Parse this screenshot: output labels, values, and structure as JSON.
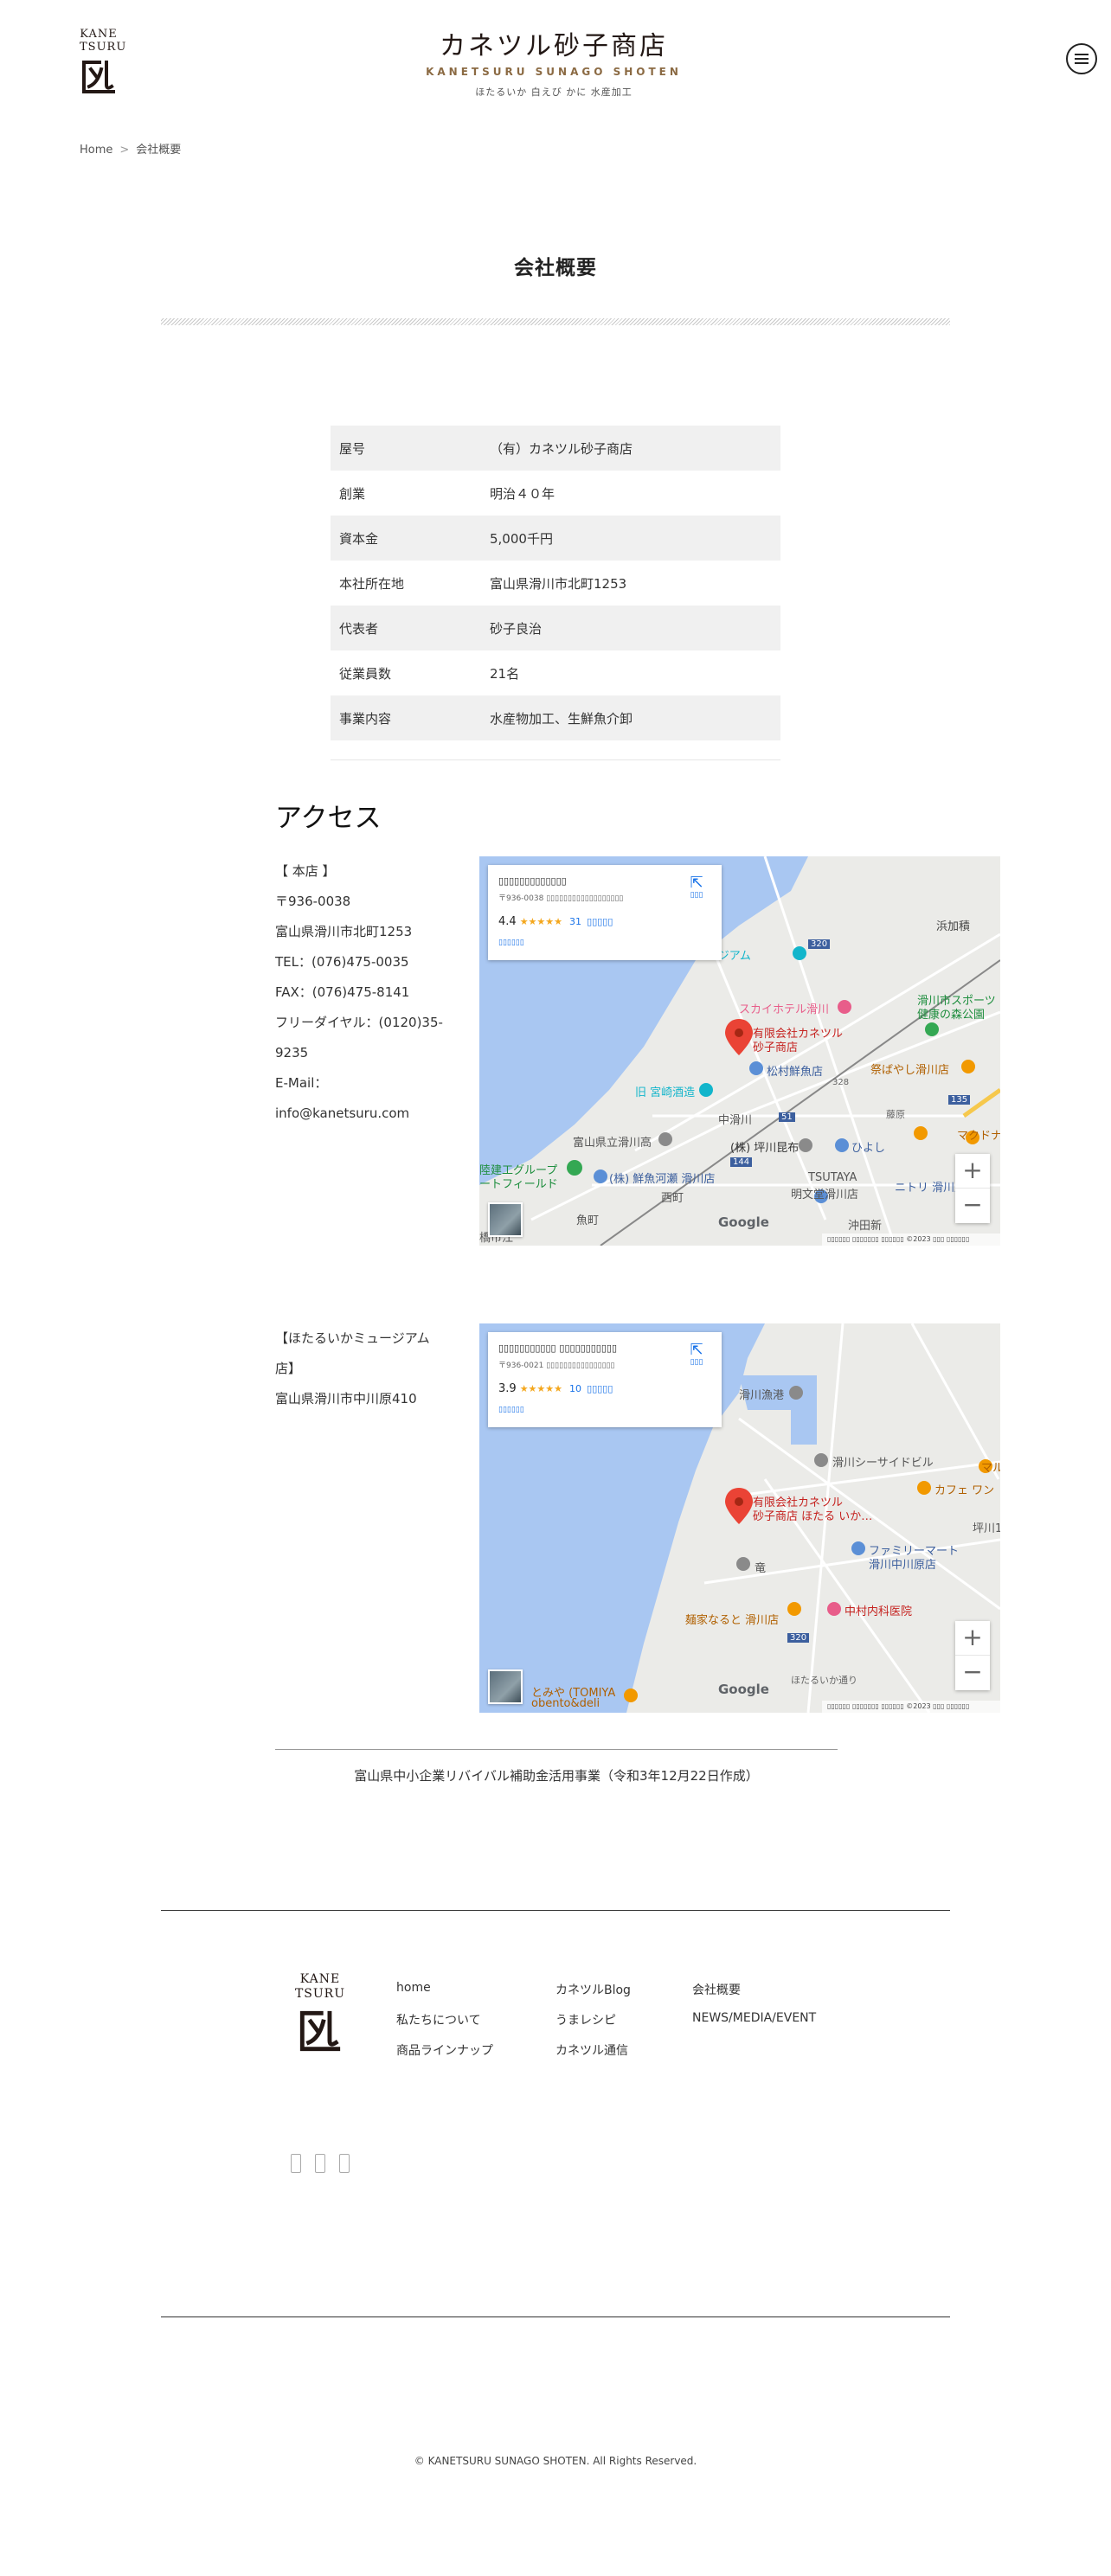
{
  "header": {
    "logo_top": "KANE",
    "logo_bottom": "TSURU",
    "brand_name": "カネツル砂子商店",
    "brand_roman": "KANETSURU SUNAGO SHOTEN",
    "brand_tagline": "ほたるいか 白えび かに 水産加工"
  },
  "breadcrumb": {
    "home": "Home",
    "separator": ">",
    "current": "会社概要"
  },
  "page_title": "会社概要",
  "company": [
    {
      "key": "屋号",
      "value": "（有）カネツル砂子商店"
    },
    {
      "key": "創業",
      "value": "明治４０年"
    },
    {
      "key": "資本金",
      "value": "5,000千円"
    },
    {
      "key": "本社所在地",
      "value": "富山県滑川市北町1253"
    },
    {
      "key": "代表者",
      "value": "砂子良治"
    },
    {
      "key": "従業員数",
      "value": "21名"
    },
    {
      "key": "事業内容",
      "value": "水産物加工、生鮮魚介卸"
    }
  ],
  "access": {
    "title": "アクセス",
    "head_office": {
      "label": "【 本店 】",
      "postal": "〒936-0038",
      "address": "富山県滑川市北町1253",
      "tel": "TEL：(076)475-0035",
      "fax": "FAX：(076)475-8141",
      "freedial_1": "フリーダイヤル：(0120)35-",
      "freedial_2": "9235",
      "email_label": "E-Mail：",
      "email": "info@kanetsuru.com"
    },
    "museum": {
      "label_1": "【ほたるいかミュージアム",
      "label_2": "店】",
      "address": "富山県滑川市中川原410"
    }
  },
  "map1": {
    "card_postal": "〒936-0038",
    "rating": "4.4",
    "stars": "★★★★★",
    "reviews": "31",
    "zoom_in": "+",
    "zoom_out": "−",
    "google": "Google",
    "footer": "©2023",
    "labels": {
      "museum": "ほたるいかミュージアム",
      "hotel": "スカイホテル滑川",
      "business": "有限会社カネツル",
      "business_2": "砂子商店",
      "matsumura": "松村鮮魚店",
      "sports": "滑川市スポーツ",
      "forest": "健康の森公園",
      "park": "滑川市",
      "hama": "浜加積",
      "matsuba": "祭ばやし滑川店",
      "kyu": "旧 宮崎酒造",
      "hs": "富山県立滑川高",
      "kombu": "(株) 坪川昆布",
      "hiyoshi": "ひよし",
      "mc": "マクドナル",
      "nitori": "ニトリ 滑川店",
      "tsutaya": "TSUTAYA",
      "tsutaya_2": "明文堂滑川店",
      "rikuken": "陸建工グループ",
      "field": "ートフィールド",
      "sengyo": "(株) 鮮魚河瀬 滑川店",
      "nishi": "西町",
      "chuo": "中滑川",
      "uozu": "魚町",
      "okita": "沖田新",
      "higashi": "橋市江",
      "r320": "320",
      "r135": "135",
      "r51": "51",
      "r144": "144",
      "r328": "328",
      "hashi": "藤原"
    }
  },
  "map2": {
    "card_postal": "〒936-0021",
    "rating": "3.9",
    "stars": "★★★★★",
    "reviews": "10",
    "zoom_in": "+",
    "zoom_out": "−",
    "google": "Google",
    "footer": "©2023",
    "labels": {
      "port": "滑川漁港",
      "seaside": "滑川シーサイドビル",
      "business": "有限会社カネツル",
      "business_2": "砂子商店 ほたる いか…",
      "cafe": "カフェ ワン",
      "maru": "マル",
      "family": "ファミリーマート",
      "family_2": "滑川中川原店",
      "nakamura": "中村内科医院",
      "ramen": "麺家なると 滑川店",
      "tomiya": "とみや (TOMIYA",
      "tomiya_2": "obento&deli",
      "tsubo": "坪川1",
      "ryu": "竜",
      "r320": "320",
      "street": "ほたるいか通り"
    }
  },
  "subsidy": "富山県中小企業リバイバル補助金活用事業（令和3年12月22日作成）",
  "footer": {
    "logo_top": "KANE",
    "logo_bottom": "TSURU",
    "links": {
      "home": "home",
      "about": "私たちについて",
      "lineup": "商品ラインナップ",
      "blog": "カネツルBlog",
      "recipe": "うまレシピ",
      "news_letter": "カネツル通信",
      "company": "会社概要",
      "news": "NEWS/MEDIA/EVENT"
    },
    "copyright": "© KANETSURU SUNAGO SHOTEN. All Rights Reserved."
  }
}
